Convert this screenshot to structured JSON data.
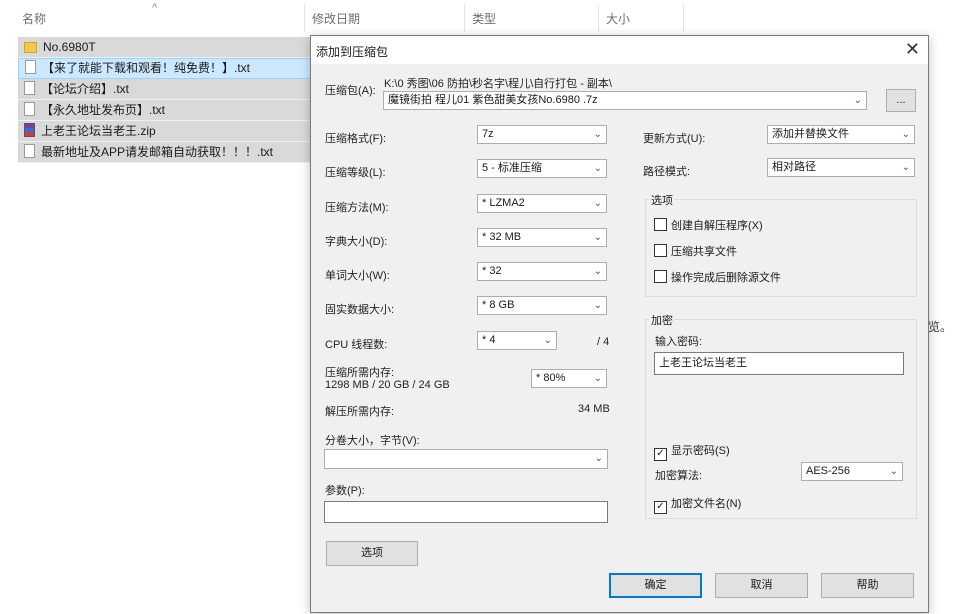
{
  "explorer": {
    "columns": {
      "name": "名称",
      "modified": "修改日期",
      "type": "类型",
      "size": "大小"
    },
    "files": [
      {
        "name": "No.6980T",
        "icon": "folder-icon"
      },
      {
        "name": "【来了就能下载和观看！纯免费！】.txt",
        "icon": "text-file-icon"
      },
      {
        "name": "【论坛介绍】.txt",
        "icon": "text-file-icon"
      },
      {
        "name": "【永久地址发布页】.txt",
        "icon": "text-file-icon"
      },
      {
        "name": "上老王论坛当老王.zip",
        "icon": "winrar-archive-icon"
      },
      {
        "name": "最新地址及APP请发邮箱自动获取！！！.txt",
        "icon": "text-file-icon"
      }
    ],
    "side_text": "览。"
  },
  "dialog": {
    "title": "添加到压缩包",
    "close_glyph": "✕",
    "archive_label": "压缩包(A):",
    "archive_path": "K:\\0 秀图\\06 防拍\\秒名字\\程儿\\自行打包 - 副本\\",
    "archive_name": "魔镜街拍 程儿01 紫色甜美女孩No.6980 .7z",
    "browse_label": "...",
    "left": {
      "format_label": "压缩格式(F):",
      "format_value": "7z",
      "level_label": "压缩等级(L):",
      "level_value": "5 - 标准压缩",
      "method_label": "压缩方法(M):",
      "method_value": "* LZMA2",
      "dict_label": "字典大小(D):",
      "dict_value": "* 32 MB",
      "word_label": "单词大小(W):",
      "word_value": "* 32",
      "solid_label": "固实数据大小:",
      "solid_value": "* 8 GB",
      "threads_label": "CPU 线程数:",
      "threads_value": "* 4",
      "threads_total": "/ 4",
      "mem_comp_label": "压缩所需内存:",
      "mem_comp_value": "1298 MB / 20 GB / 24 GB",
      "mem_percent": "* 80%",
      "mem_decomp_label": "解压所需内存:",
      "mem_decomp_value": "34 MB",
      "split_label": "分卷大小，字节(V):",
      "split_value": "",
      "params_label": "参数(P):",
      "params_value": "",
      "options_button": "选项"
    },
    "right": {
      "update_label": "更新方式(U):",
      "update_value": "添加并替换文件",
      "path_label": "路径模式:",
      "path_value": "相对路径",
      "options_group": "选项",
      "opt_sfx": "创建自解压程序(X)",
      "opt_shared": "压缩共享文件",
      "opt_delete": "操作完成后删除源文件",
      "encrypt_group": "加密",
      "password_label": "输入密码:",
      "password_value": "上老王论坛当老王",
      "show_password": "显示密码(S)",
      "enc_method_label": "加密算法:",
      "enc_method_value": "AES-256",
      "encrypt_names": "加密文件名(N)"
    },
    "buttons": {
      "ok": "确定",
      "cancel": "取消",
      "help": "帮助"
    }
  }
}
